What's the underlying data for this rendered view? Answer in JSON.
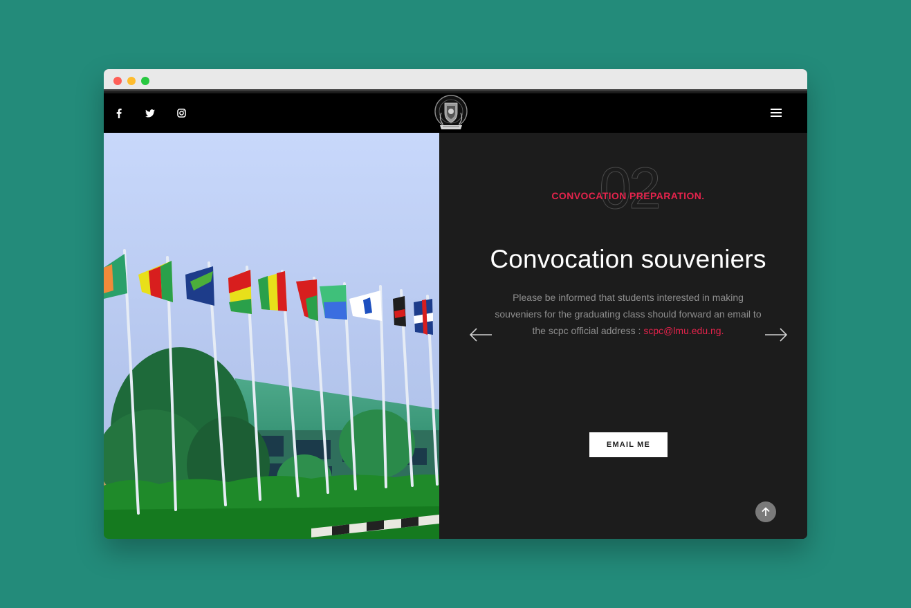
{
  "navbar": {
    "social": [
      {
        "name": "facebook",
        "icon": "facebook-icon"
      },
      {
        "name": "twitter",
        "icon": "twitter-icon"
      },
      {
        "name": "instagram",
        "icon": "instagram-icon"
      }
    ],
    "logo_icon": "university-crest-logo",
    "menu_icon": "hamburger-menu-icon"
  },
  "slide": {
    "number": "02",
    "eyebrow": "CONVOCATION PREPARATION.",
    "title": "Convocation souveniers",
    "body": "Please be informed that students interested in making souveniers for the graduating class should forward an email to the scpc official address : ",
    "email": "scpc@lmu.edu.ng.",
    "button_label": "EMAIL ME",
    "prev_icon": "arrow-left-icon",
    "next_icon": "arrow-right-icon"
  },
  "scroll_top_icon": "arrow-up-icon",
  "colors": {
    "page_bg": "#238b7a",
    "accent": "#e5234c",
    "panel_bg": "#1c1c1c",
    "navbar_bg": "#000000"
  }
}
